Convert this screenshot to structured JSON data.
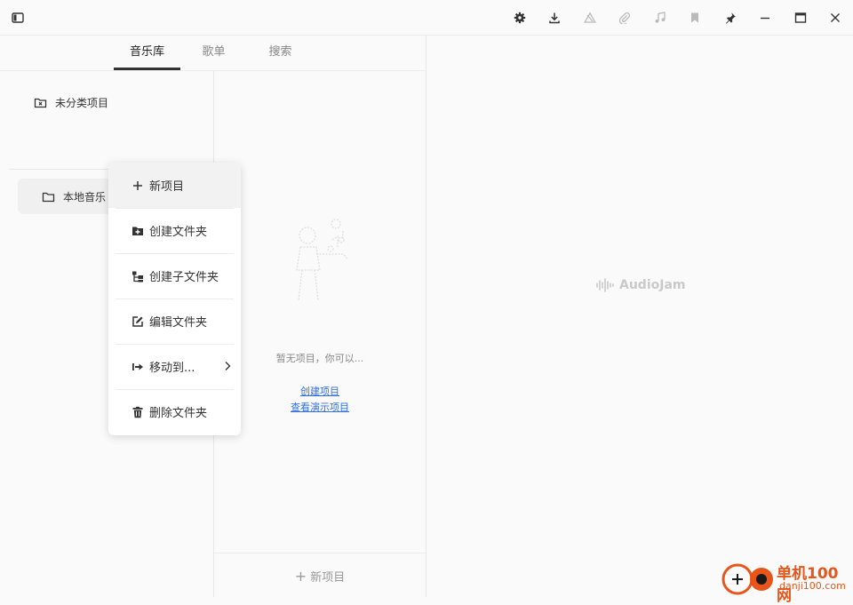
{
  "toolbar": {
    "icons": [
      "sidebar-toggle-icon",
      "gear-icon",
      "download-icon",
      "warning-icon",
      "paperclip-icon",
      "music-note-icon",
      "bookmark-icon",
      "pin-icon",
      "minimize-icon",
      "maximize-icon",
      "close-icon"
    ]
  },
  "tabs": [
    {
      "label": "音乐库",
      "active": true
    },
    {
      "label": "歌单",
      "active": false
    },
    {
      "label": "搜索",
      "active": false
    }
  ],
  "sidebar": {
    "uncategorized_label": "未分类项目",
    "folder_label": "本地音乐"
  },
  "items_panel": {
    "empty_text": "暂无项目，你可以...",
    "create_link": "创建项目",
    "demo_link": "查看演示项目",
    "new_item_label": "新项目",
    "new_item_plus": "+"
  },
  "detail": {
    "logo_text": "AudioJam"
  },
  "context_menu": {
    "items": [
      {
        "label": "新项目",
        "icon": "plus-icon"
      },
      {
        "label": "创建文件夹",
        "icon": "folder-plus-icon"
      },
      {
        "label": "创建子文件夹",
        "icon": "subfolder-icon"
      },
      {
        "label": "编辑文件夹",
        "icon": "edit-icon"
      },
      {
        "label": "移动到...",
        "icon": "move-icon"
      },
      {
        "label": "删除文件夹",
        "icon": "trash-icon"
      }
    ]
  },
  "watermark": {
    "title": "单机100网",
    "url": "danji100.com"
  }
}
